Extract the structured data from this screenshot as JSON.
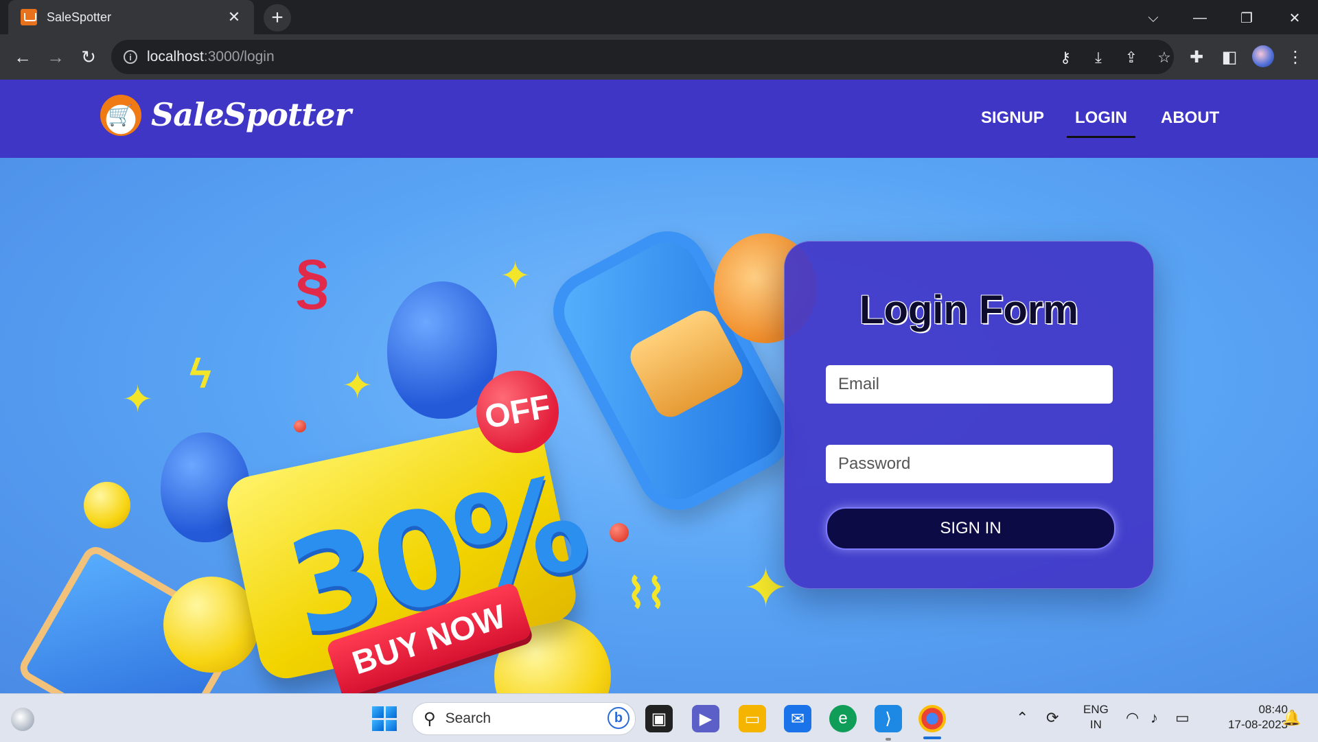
{
  "browser": {
    "tab_title": "SaleSpotter",
    "tab_close": "✕",
    "new_tab": "+",
    "url_host": "localhost",
    "url_rest": ":3000/login",
    "window_controls": {
      "dropdown": "⌵",
      "minimize": "—",
      "restore": "❐",
      "close": "✕"
    }
  },
  "navbar": {
    "brand": "SaleSpotter",
    "links": [
      "SIGNUP",
      "LOGIN",
      "ABOUT"
    ],
    "active_link": "LOGIN"
  },
  "hero": {
    "promo_percent": "30%",
    "promo_off": "OFF",
    "promo_cta": "BUY NOW"
  },
  "login": {
    "title": "Login Form",
    "email_placeholder": "Email",
    "password_placeholder": "Password",
    "submit_label": "SIGN IN"
  },
  "taskbar": {
    "search_label": "Search",
    "language_top": "ENG",
    "language_bottom": "IN",
    "time": "08:40",
    "date": "17-08-2023"
  },
  "colors": {
    "navbar_bg": "#3f36c6",
    "card_bg": "#4238c8",
    "button_bg": "#0d0b45",
    "hero_bg": "#5aa5f5"
  }
}
